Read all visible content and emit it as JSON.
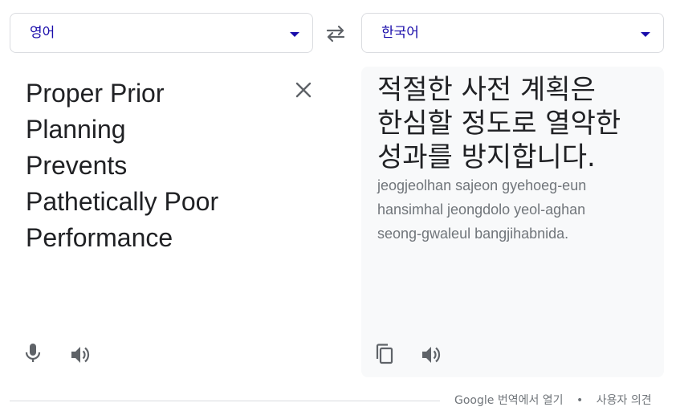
{
  "source_language": {
    "label": "영어"
  },
  "target_language": {
    "label": "한국어"
  },
  "source": {
    "lines": [
      "Proper Prior",
      "Planning",
      "Prevents",
      "Pathetically Poor",
      "Performance"
    ]
  },
  "target": {
    "lines": [
      "적절한 사전 계획은",
      "한심할 정도로 열악한",
      "성과를 방지합니다."
    ],
    "romanized_lines": [
      "jeogjeolhan sajeon gyehoeg-eun",
      "hansimhal jeongdolo yeol-aghan",
      "seong-gwaleul bangjihabnida."
    ]
  },
  "footer": {
    "open_link": "Google 번역에서 열기",
    "separator": "•",
    "feedback_link": "사용자 의견"
  },
  "icons": {
    "swap": "swap-arrows-icon",
    "clear": "close-icon",
    "mic": "microphone-icon",
    "speaker": "speaker-icon",
    "copy": "copy-icon"
  },
  "colors": {
    "accent": "#1a0dab",
    "text": "#202124",
    "muted": "#70757a",
    "border": "#dadce0",
    "panel": "#f8f9fa"
  }
}
